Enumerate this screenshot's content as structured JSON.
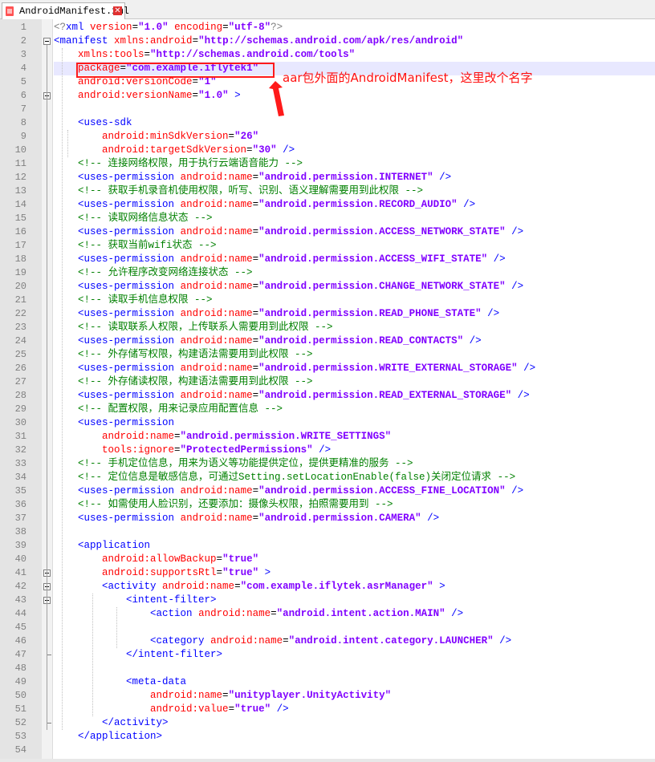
{
  "tab": {
    "label": "AndroidManifest.xml",
    "close": "✕",
    "file_icon": "xml-file-icon"
  },
  "annotation": {
    "text": "aar包外面的AndroidManifest，这里改个名字",
    "color": "#ff1111"
  },
  "highlighted_line": 4,
  "colors": {
    "tag": "#0000ff",
    "attribute": "#ff0000",
    "value": "#8000ff",
    "comment": "#008000",
    "text": "#000000"
  },
  "fold_lines": [
    2,
    6,
    41,
    42,
    43
  ],
  "fold_end_lines": [
    47,
    52
  ],
  "lines": [
    [
      [
        "g",
        "<?"
      ],
      [
        "tag",
        "xml"
      ],
      [
        "txt",
        " "
      ],
      [
        "attr",
        "version"
      ],
      [
        "txt",
        "="
      ],
      [
        "val",
        "\"1.0\""
      ],
      [
        "txt",
        " "
      ],
      [
        "attr",
        "encoding"
      ],
      [
        "txt",
        "="
      ],
      [
        "val",
        "\"utf-8\""
      ],
      [
        "g",
        "?>"
      ]
    ],
    [
      [
        "tag",
        "<manifest"
      ],
      [
        "txt",
        " "
      ],
      [
        "attr",
        "xmlns:android"
      ],
      [
        "txt",
        "="
      ],
      [
        "val",
        "\"http://schemas.android.com/apk/res/android\""
      ]
    ],
    [
      [
        "txt",
        "    "
      ],
      [
        "attr",
        "xmlns:tools"
      ],
      [
        "txt",
        "="
      ],
      [
        "val",
        "\"http://schemas.android.com/tools\""
      ]
    ],
    [
      [
        "txt",
        "    "
      ],
      [
        "attr",
        "package"
      ],
      [
        "txt",
        "="
      ],
      [
        "val",
        "\"com.example.iflytek1\""
      ]
    ],
    [
      [
        "txt",
        "    "
      ],
      [
        "attr",
        "android:versionCode"
      ],
      [
        "txt",
        "="
      ],
      [
        "val",
        "\"1\""
      ]
    ],
    [
      [
        "txt",
        "    "
      ],
      [
        "attr",
        "android:versionName"
      ],
      [
        "txt",
        "="
      ],
      [
        "val",
        "\"1.0\""
      ],
      [
        "txt",
        " "
      ],
      [
        "tag",
        ">"
      ]
    ],
    [],
    [
      [
        "txt",
        "    "
      ],
      [
        "tag",
        "<uses-sdk"
      ]
    ],
    [
      [
        "txt",
        "        "
      ],
      [
        "attr",
        "android:minSdkVersion"
      ],
      [
        "txt",
        "="
      ],
      [
        "val",
        "\"26\""
      ]
    ],
    [
      [
        "txt",
        "        "
      ],
      [
        "attr",
        "android:targetSdkVersion"
      ],
      [
        "txt",
        "="
      ],
      [
        "val",
        "\"30\""
      ],
      [
        "txt",
        " "
      ],
      [
        "tag",
        "/>"
      ]
    ],
    [
      [
        "txt",
        "    "
      ],
      [
        "cm",
        "<!-- 连接网络权限，用于执行云端语音能力 -->"
      ]
    ],
    [
      [
        "txt",
        "    "
      ],
      [
        "tag",
        "<uses-permission"
      ],
      [
        "txt",
        " "
      ],
      [
        "attr",
        "android:name"
      ],
      [
        "txt",
        "="
      ],
      [
        "val",
        "\"android.permission.INTERNET\""
      ],
      [
        "txt",
        " "
      ],
      [
        "tag",
        "/>"
      ]
    ],
    [
      [
        "txt",
        "    "
      ],
      [
        "cm",
        "<!-- 获取手机录音机使用权限，听写、识别、语义理解需要用到此权限 -->"
      ]
    ],
    [
      [
        "txt",
        "    "
      ],
      [
        "tag",
        "<uses-permission"
      ],
      [
        "txt",
        " "
      ],
      [
        "attr",
        "android:name"
      ],
      [
        "txt",
        "="
      ],
      [
        "val",
        "\"android.permission.RECORD_AUDIO\""
      ],
      [
        "txt",
        " "
      ],
      [
        "tag",
        "/>"
      ]
    ],
    [
      [
        "txt",
        "    "
      ],
      [
        "cm",
        "<!-- 读取网络信息状态 -->"
      ]
    ],
    [
      [
        "txt",
        "    "
      ],
      [
        "tag",
        "<uses-permission"
      ],
      [
        "txt",
        " "
      ],
      [
        "attr",
        "android:name"
      ],
      [
        "txt",
        "="
      ],
      [
        "val",
        "\"android.permission.ACCESS_NETWORK_STATE\""
      ],
      [
        "txt",
        " "
      ],
      [
        "tag",
        "/>"
      ]
    ],
    [
      [
        "txt",
        "    "
      ],
      [
        "cm",
        "<!-- 获取当前wifi状态 -->"
      ]
    ],
    [
      [
        "txt",
        "    "
      ],
      [
        "tag",
        "<uses-permission"
      ],
      [
        "txt",
        " "
      ],
      [
        "attr",
        "android:name"
      ],
      [
        "txt",
        "="
      ],
      [
        "val",
        "\"android.permission.ACCESS_WIFI_STATE\""
      ],
      [
        "txt",
        " "
      ],
      [
        "tag",
        "/>"
      ]
    ],
    [
      [
        "txt",
        "    "
      ],
      [
        "cm",
        "<!-- 允许程序改变网络连接状态 -->"
      ]
    ],
    [
      [
        "txt",
        "    "
      ],
      [
        "tag",
        "<uses-permission"
      ],
      [
        "txt",
        " "
      ],
      [
        "attr",
        "android:name"
      ],
      [
        "txt",
        "="
      ],
      [
        "val",
        "\"android.permission.CHANGE_NETWORK_STATE\""
      ],
      [
        "txt",
        " "
      ],
      [
        "tag",
        "/>"
      ]
    ],
    [
      [
        "txt",
        "    "
      ],
      [
        "cm",
        "<!-- 读取手机信息权限 -->"
      ]
    ],
    [
      [
        "txt",
        "    "
      ],
      [
        "tag",
        "<uses-permission"
      ],
      [
        "txt",
        " "
      ],
      [
        "attr",
        "android:name"
      ],
      [
        "txt",
        "="
      ],
      [
        "val",
        "\"android.permission.READ_PHONE_STATE\""
      ],
      [
        "txt",
        " "
      ],
      [
        "tag",
        "/>"
      ]
    ],
    [
      [
        "txt",
        "    "
      ],
      [
        "cm",
        "<!-- 读取联系人权限，上传联系人需要用到此权限 -->"
      ]
    ],
    [
      [
        "txt",
        "    "
      ],
      [
        "tag",
        "<uses-permission"
      ],
      [
        "txt",
        " "
      ],
      [
        "attr",
        "android:name"
      ],
      [
        "txt",
        "="
      ],
      [
        "val",
        "\"android.permission.READ_CONTACTS\""
      ],
      [
        "txt",
        " "
      ],
      [
        "tag",
        "/>"
      ]
    ],
    [
      [
        "txt",
        "    "
      ],
      [
        "cm",
        "<!-- 外存储写权限，构建语法需要用到此权限 -->"
      ]
    ],
    [
      [
        "txt",
        "    "
      ],
      [
        "tag",
        "<uses-permission"
      ],
      [
        "txt",
        " "
      ],
      [
        "attr",
        "android:name"
      ],
      [
        "txt",
        "="
      ],
      [
        "val",
        "\"android.permission.WRITE_EXTERNAL_STORAGE\""
      ],
      [
        "txt",
        " "
      ],
      [
        "tag",
        "/>"
      ]
    ],
    [
      [
        "txt",
        "    "
      ],
      [
        "cm",
        "<!-- 外存储读权限，构建语法需要用到此权限 -->"
      ]
    ],
    [
      [
        "txt",
        "    "
      ],
      [
        "tag",
        "<uses-permission"
      ],
      [
        "txt",
        " "
      ],
      [
        "attr",
        "android:name"
      ],
      [
        "txt",
        "="
      ],
      [
        "val",
        "\"android.permission.READ_EXTERNAL_STORAGE\""
      ],
      [
        "txt",
        " "
      ],
      [
        "tag",
        "/>"
      ]
    ],
    [
      [
        "txt",
        "    "
      ],
      [
        "cm",
        "<!-- 配置权限，用来记录应用配置信息 -->"
      ]
    ],
    [
      [
        "txt",
        "    "
      ],
      [
        "tag",
        "<uses-permission"
      ]
    ],
    [
      [
        "txt",
        "        "
      ],
      [
        "attr",
        "android:name"
      ],
      [
        "txt",
        "="
      ],
      [
        "val",
        "\"android.permission.WRITE_SETTINGS\""
      ]
    ],
    [
      [
        "txt",
        "        "
      ],
      [
        "attr",
        "tools:ignore"
      ],
      [
        "txt",
        "="
      ],
      [
        "val",
        "\"ProtectedPermissions\""
      ],
      [
        "txt",
        " "
      ],
      [
        "tag",
        "/>"
      ]
    ],
    [
      [
        "txt",
        "    "
      ],
      [
        "cm",
        "<!-- 手机定位信息，用来为语义等功能提供定位，提供更精准的服务 -->"
      ]
    ],
    [
      [
        "txt",
        "    "
      ],
      [
        "cm",
        "<!-- 定位信息是敏感信息，可通过Setting.setLocationEnable(false)关闭定位请求 -->"
      ]
    ],
    [
      [
        "txt",
        "    "
      ],
      [
        "tag",
        "<uses-permission"
      ],
      [
        "txt",
        " "
      ],
      [
        "attr",
        "android:name"
      ],
      [
        "txt",
        "="
      ],
      [
        "val",
        "\"android.permission.ACCESS_FINE_LOCATION\""
      ],
      [
        "txt",
        " "
      ],
      [
        "tag",
        "/>"
      ]
    ],
    [
      [
        "txt",
        "    "
      ],
      [
        "cm",
        "<!-- 如需使用人脸识别，还要添加：摄像头权限，拍照需要用到 -->"
      ]
    ],
    [
      [
        "txt",
        "    "
      ],
      [
        "tag",
        "<uses-permission"
      ],
      [
        "txt",
        " "
      ],
      [
        "attr",
        "android:name"
      ],
      [
        "txt",
        "="
      ],
      [
        "val",
        "\"android.permission.CAMERA\""
      ],
      [
        "txt",
        " "
      ],
      [
        "tag",
        "/>"
      ]
    ],
    [],
    [
      [
        "txt",
        "    "
      ],
      [
        "tag",
        "<application"
      ]
    ],
    [
      [
        "txt",
        "        "
      ],
      [
        "attr",
        "android:allowBackup"
      ],
      [
        "txt",
        "="
      ],
      [
        "val",
        "\"true\""
      ]
    ],
    [
      [
        "txt",
        "        "
      ],
      [
        "attr",
        "android:supportsRtl"
      ],
      [
        "txt",
        "="
      ],
      [
        "val",
        "\"true\""
      ],
      [
        "txt",
        " "
      ],
      [
        "tag",
        ">"
      ]
    ],
    [
      [
        "txt",
        "        "
      ],
      [
        "tag",
        "<activity"
      ],
      [
        "txt",
        " "
      ],
      [
        "attr",
        "android:name"
      ],
      [
        "txt",
        "="
      ],
      [
        "val",
        "\"com.example.iflytek.asrManager\""
      ],
      [
        "txt",
        " "
      ],
      [
        "tag",
        ">"
      ]
    ],
    [
      [
        "txt",
        "            "
      ],
      [
        "tag",
        "<intent-filter>"
      ]
    ],
    [
      [
        "txt",
        "                "
      ],
      [
        "tag",
        "<action"
      ],
      [
        "txt",
        " "
      ],
      [
        "attr",
        "android:name"
      ],
      [
        "txt",
        "="
      ],
      [
        "val",
        "\"android.intent.action.MAIN\""
      ],
      [
        "txt",
        " "
      ],
      [
        "tag",
        "/>"
      ]
    ],
    [],
    [
      [
        "txt",
        "                "
      ],
      [
        "tag",
        "<category"
      ],
      [
        "txt",
        " "
      ],
      [
        "attr",
        "android:name"
      ],
      [
        "txt",
        "="
      ],
      [
        "val",
        "\"android.intent.category.LAUNCHER\""
      ],
      [
        "txt",
        " "
      ],
      [
        "tag",
        "/>"
      ]
    ],
    [
      [
        "txt",
        "            "
      ],
      [
        "tag",
        "</intent-filter>"
      ]
    ],
    [],
    [
      [
        "txt",
        "            "
      ],
      [
        "tag",
        "<meta-data"
      ]
    ],
    [
      [
        "txt",
        "                "
      ],
      [
        "attr",
        "android:name"
      ],
      [
        "txt",
        "="
      ],
      [
        "val",
        "\"unityplayer.UnityActivity\""
      ]
    ],
    [
      [
        "txt",
        "                "
      ],
      [
        "attr",
        "android:value"
      ],
      [
        "txt",
        "="
      ],
      [
        "val",
        "\"true\""
      ],
      [
        "txt",
        " "
      ],
      [
        "tag",
        "/>"
      ]
    ],
    [
      [
        "txt",
        "        "
      ],
      [
        "tag",
        "</activity>"
      ]
    ],
    [
      [
        "txt",
        "    "
      ],
      [
        "tag",
        "</application>"
      ]
    ],
    []
  ]
}
